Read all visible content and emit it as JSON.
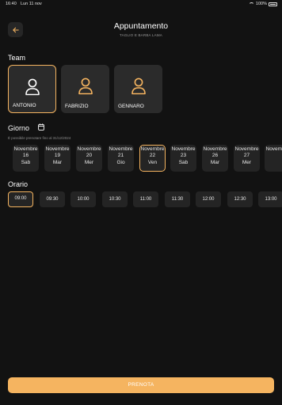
{
  "status": {
    "time": "16:40",
    "date": "Lun 11 nov",
    "battery": "100%"
  },
  "header": {
    "title": "Appuntamento",
    "subtitle": "TAGLIO E BARBA LAMA"
  },
  "team": {
    "label": "Team",
    "members": [
      {
        "name": "ANTONIO",
        "selected": true
      },
      {
        "name": "FABRIZIO",
        "selected": false
      },
      {
        "name": "GENNARO",
        "selected": false
      }
    ]
  },
  "day": {
    "label": "Giorno",
    "note": "È possibile prenotare fino al 31/12/2024",
    "days": [
      {
        "month": "Novembre",
        "num": "16",
        "dow": "Sab"
      },
      {
        "month": "Novembre",
        "num": "19",
        "dow": "Mar"
      },
      {
        "month": "Novembre",
        "num": "20",
        "dow": "Mer"
      },
      {
        "month": "Novembre",
        "num": "21",
        "dow": "Gio"
      },
      {
        "month": "Novembre",
        "num": "22",
        "dow": "Ven"
      },
      {
        "month": "Novembre",
        "num": "23",
        "dow": "Sab"
      },
      {
        "month": "Novembre",
        "num": "26",
        "dow": "Mar"
      },
      {
        "month": "Novembre",
        "num": "27",
        "dow": "Mer"
      },
      {
        "month": "Novembre",
        "num": "",
        "dow": ""
      }
    ],
    "selected_index": 4
  },
  "time": {
    "label": "Orario",
    "slots": [
      "09:00",
      "09:30",
      "10:00",
      "10:30",
      "11:00",
      "11:30",
      "12:00",
      "12:30",
      "13:00"
    ],
    "selected_index": 0
  },
  "action": {
    "book_label": "PRENOTA"
  },
  "colors": {
    "accent": "#f5b460",
    "card": "#2b2b2b",
    "background": "#121212"
  },
  "icons": [
    "back-arrow-icon",
    "user-icon",
    "calendar-icon",
    "wifi-icon",
    "battery-icon"
  ]
}
